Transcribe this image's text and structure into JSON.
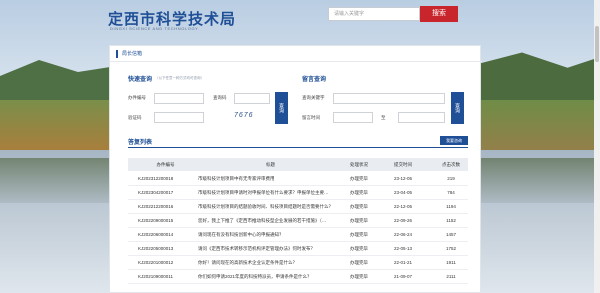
{
  "header": {
    "title": "定西市科学技术局",
    "subtitle": "DINGXI SCIENCE AND TECHNOLOGY",
    "search_placeholder": "请输入关键字",
    "search_button": "搜索"
  },
  "breadcrumb": "局长信箱",
  "quick_query": {
    "title": "快速查询",
    "note": "（以下任意一种方式均可查询）",
    "label_name": "办件编号",
    "label_pwd": "查询码",
    "label_code": "验证码",
    "captcha": "7676",
    "button": "查询"
  },
  "message_query": {
    "title": "留言查询",
    "label_keyword": "查询关键字",
    "label_time": "留言时间",
    "to": "至",
    "button": "查询"
  },
  "list": {
    "title": "答复列表",
    "consult_button": "我要咨询",
    "headers": [
      "办件编号",
      "标题",
      "处理状况",
      "提交时间",
      "点击次数"
    ],
    "rows": [
      [
        "KJ202312200018",
        "市级科技计划项目中有无专家评审费用",
        "办理完毕",
        "23-12-05",
        "219"
      ],
      [
        "KJ202304200017",
        "市级科技计划项目申请时对申报单位有什么要求？申报单位主要…",
        "办理完毕",
        "23-04-05",
        "784"
      ],
      [
        "KJ202212200016",
        "市级科技计划项目的结题验收时间、科技项目结题时是否需要什么？",
        "办理完毕",
        "22-12-05",
        "1194"
      ],
      [
        "KJ202209000015",
        "您好，我上下推了《定西市推动科技型企业发展的若干措施》（…",
        "办理完毕",
        "22-09-26",
        "1152"
      ],
      [
        "KJ202206000014",
        "请问现在有没有科技创新中心的申报通知？",
        "办理完毕",
        "22-06-24",
        "1457"
      ],
      [
        "KJ202205000013",
        "请问《定西市技术转移示范机构评定管理办法》何时发布？",
        "办理完毕",
        "22-05-13",
        "1752"
      ],
      [
        "KJ202201000012",
        "你好！请问现在的高新技术企业认定条件是什么？",
        "办理完毕",
        "22-01-21",
        "1911"
      ],
      [
        "KJ202109000011",
        "你们如何申请2021年度的科技特派员，申请条件是什么？",
        "办理完毕",
        "21-09-07",
        "2111"
      ]
    ]
  }
}
